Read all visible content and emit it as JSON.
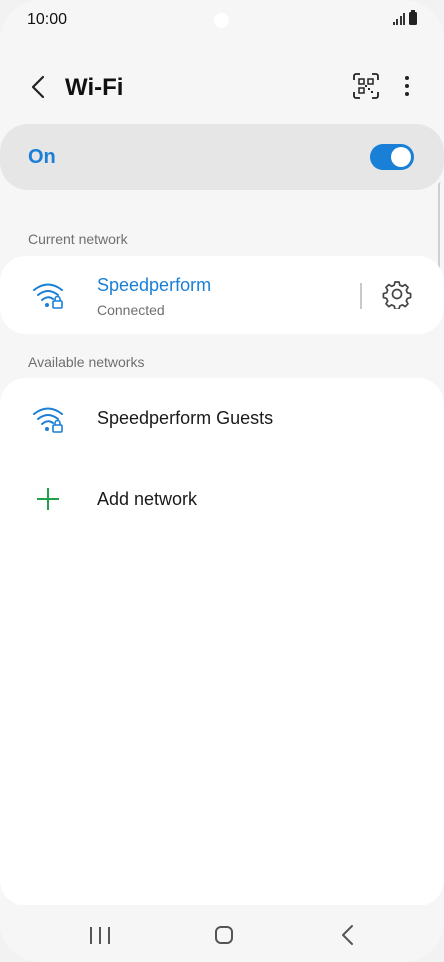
{
  "status_bar": {
    "time": "10:00"
  },
  "header": {
    "title": "Wi-Fi"
  },
  "master_toggle": {
    "label": "On",
    "state": "on",
    "accent_color": "#1a7fd6"
  },
  "current_network": {
    "section_label": "Current network",
    "name": "Speedperform",
    "status": "Connected",
    "icon": "wifi-locked-icon"
  },
  "available_networks": {
    "section_label": "Available networks",
    "items": [
      {
        "name": "Speedperform Guests",
        "icon": "wifi-locked-icon"
      }
    ],
    "add_label": "Add network",
    "add_color": "#1ea34a"
  },
  "nav_bar": {
    "recents_icon": "recent-apps-icon",
    "home_icon": "home-icon",
    "back_icon": "back-icon"
  }
}
